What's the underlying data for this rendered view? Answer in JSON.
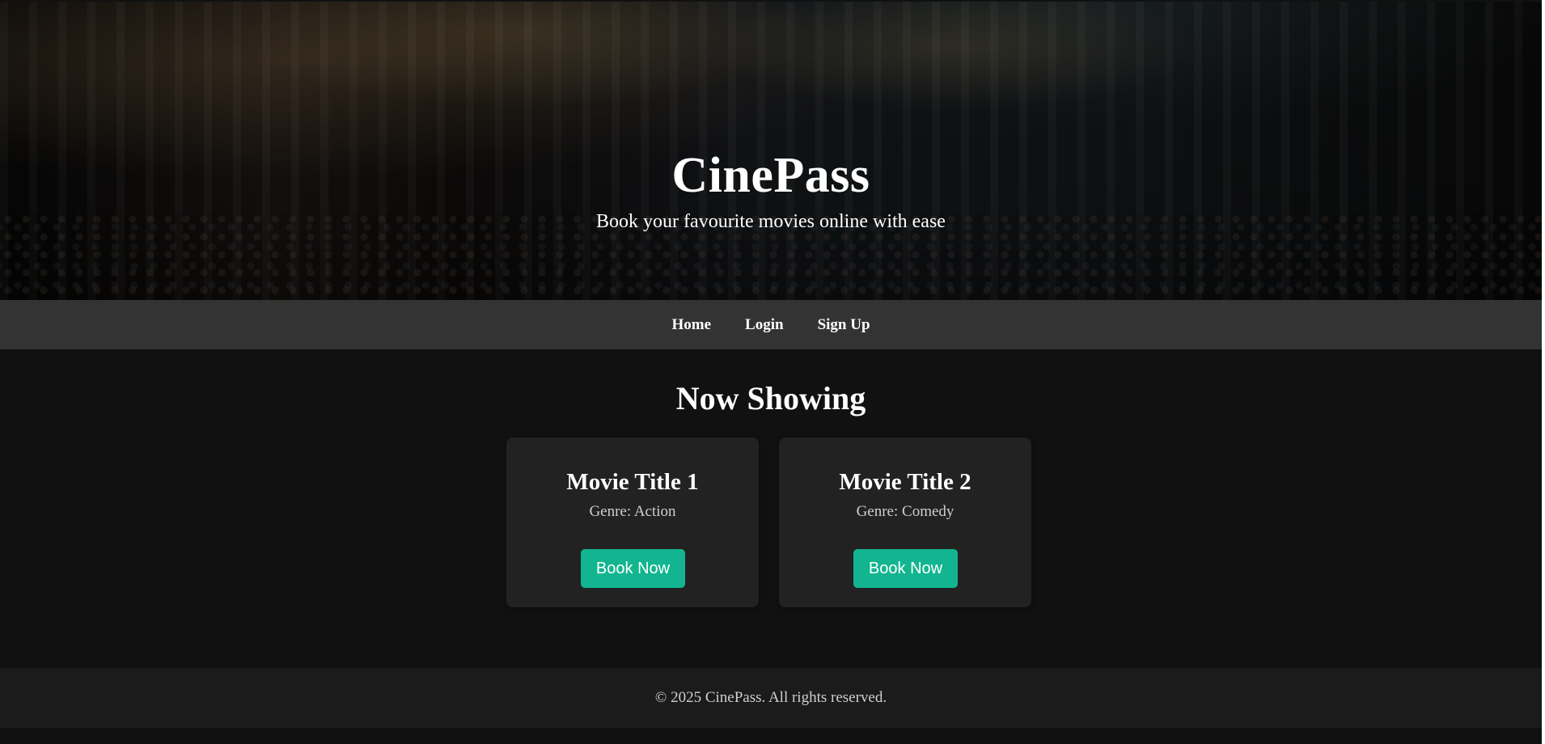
{
  "header": {
    "title": "CinePass",
    "subtitle": "Book your favourite movies online with ease"
  },
  "nav": {
    "items": [
      {
        "label": "Home"
      },
      {
        "label": "Login"
      },
      {
        "label": "Sign Up"
      }
    ]
  },
  "main": {
    "section_title": "Now Showing",
    "movies": [
      {
        "title": "Movie Title 1",
        "genre": "Genre: Action",
        "button_label": "Book Now"
      },
      {
        "title": "Movie Title 2",
        "genre": "Genre: Comedy",
        "button_label": "Book Now"
      }
    ]
  },
  "footer": {
    "text": "© 2025 CinePass. All rights reserved."
  },
  "colors": {
    "background": "#111111",
    "nav_background": "#333333",
    "card_background": "#222222",
    "footer_background": "#1b1b1b",
    "accent": "#12b58f",
    "text_primary": "#ffffff",
    "text_secondary": "#cfcfcf"
  }
}
